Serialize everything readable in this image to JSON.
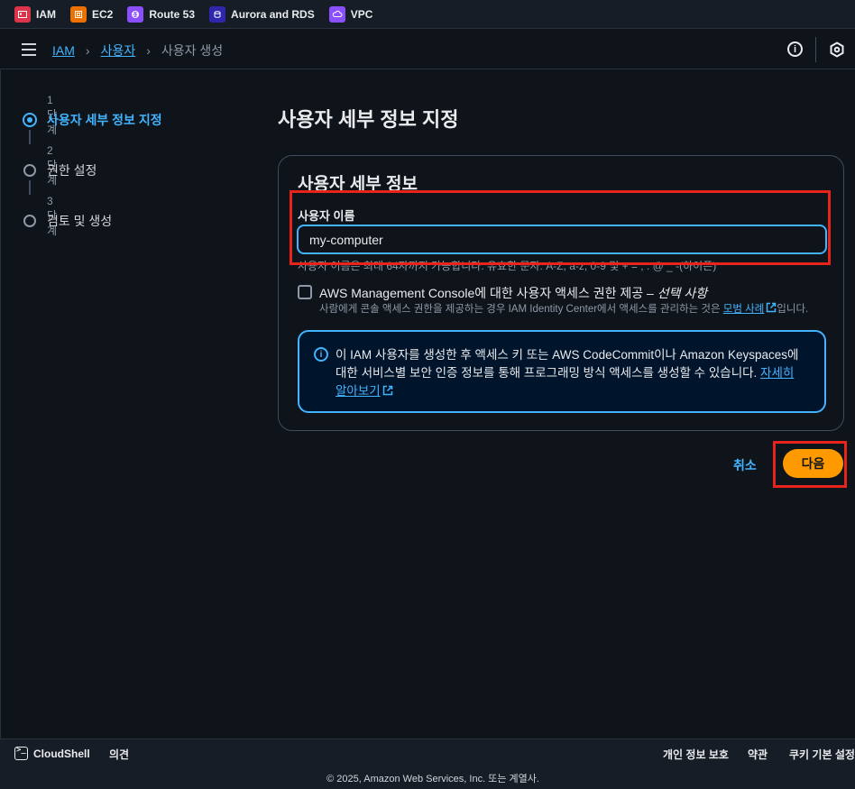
{
  "favorites": [
    {
      "label": "IAM",
      "icon": "iam-icon",
      "color": "#dd344c"
    },
    {
      "label": "EC2",
      "icon": "ec2-icon",
      "color": "#ed7100"
    },
    {
      "label": "Route 53",
      "icon": "route53-icon",
      "color": "#8c4fff"
    },
    {
      "label": "Aurora and RDS",
      "icon": "rds-icon",
      "color": "#2e27ad"
    },
    {
      "label": "VPC",
      "icon": "vpc-icon",
      "color": "#8c4fff"
    }
  ],
  "breadcrumb": {
    "root": "IAM",
    "parent": "사용자",
    "current": "사용자 생성",
    "separator": "›"
  },
  "steps": [
    {
      "num": "1단계",
      "label": "사용자 세부 정보 지정",
      "active": true
    },
    {
      "num": "2단계",
      "label": "권한 설정",
      "active": false
    },
    {
      "num": "3단계",
      "label": "검토 및 생성",
      "active": false
    }
  ],
  "main": {
    "title": "사용자 세부 정보 지정",
    "panel_title": "사용자 세부 정보",
    "username_label": "사용자 이름",
    "username_value": "my-computer",
    "username_hint": "사용자 이름은 최대 64자까지 가능합니다. 유효한 문자: A-Z, a-z, 0-9 및 + = , . @ _ -(하이픈)",
    "console_access_label": "AWS Management Console에 대한 사용자 액세스 권한 제공 – ",
    "console_access_optional": "선택 사항",
    "console_access_desc_prefix": "사람에게 콘솔 액세스 권한을 제공하는 경우 IAM Identity Center에서 액세스를 관리하는 것은 ",
    "console_access_desc_link": "모범 사례",
    "console_access_desc_suffix": "입니다.",
    "console_access_checked": false,
    "info_text": "이 IAM 사용자를 생성한 후 액세스 키 또는 AWS CodeCommit이나 Amazon Keyspaces에 대한 서비스별 보안 인증 정보를 통해 프로그래밍 방식 액세스를 생성할 수 있습니다. ",
    "info_link": "자세히 알아보기",
    "cancel_label": "취소",
    "next_label": "다음"
  },
  "footer": {
    "cloudshell": "CloudShell",
    "feedback": "의견",
    "privacy": "개인 정보 보호",
    "terms": "약관",
    "cookies": "쿠키 기본 설정",
    "copyright": "© 2025, Amazon Web Services, Inc. 또는 계열사."
  },
  "colors": {
    "accent": "#42b4ff",
    "primary_button": "#ff9900",
    "highlight": "#e8231a",
    "background": "#0f141a"
  }
}
